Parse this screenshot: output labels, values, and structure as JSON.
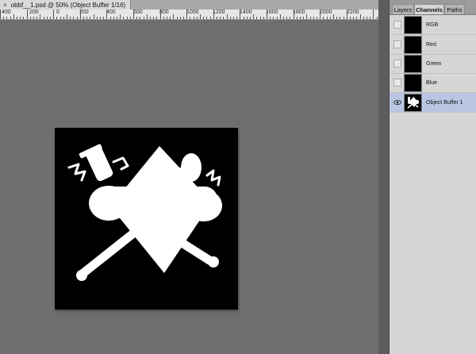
{
  "document": {
    "tab_title": "obbf__1.psd @ 50% (Object Buffer 1/16)",
    "close_glyph": "×"
  },
  "ruler": {
    "labels": [
      "400",
      "200",
      "0",
      "200",
      "400",
      "600",
      "800",
      "1000",
      "1200",
      "1400",
      "1600",
      "1800",
      "2000",
      "2200"
    ]
  },
  "panel": {
    "tabs": [
      {
        "label": "Layers",
        "active": false
      },
      {
        "label": "Channels",
        "active": true
      },
      {
        "label": "Paths",
        "active": false
      }
    ],
    "channels": [
      {
        "name": "RGB",
        "visible": false,
        "selected": false
      },
      {
        "name": "Red",
        "visible": false,
        "selected": false
      },
      {
        "name": "Green",
        "visible": false,
        "selected": false
      },
      {
        "name": "Blue",
        "visible": false,
        "selected": false
      },
      {
        "name": "Object Buffer 1",
        "visible": true,
        "selected": true
      }
    ]
  },
  "colors": {
    "canvas_bg": "#6e6e6e",
    "selection": "#b8c6e3",
    "panel_bg": "#d6d6d6"
  }
}
